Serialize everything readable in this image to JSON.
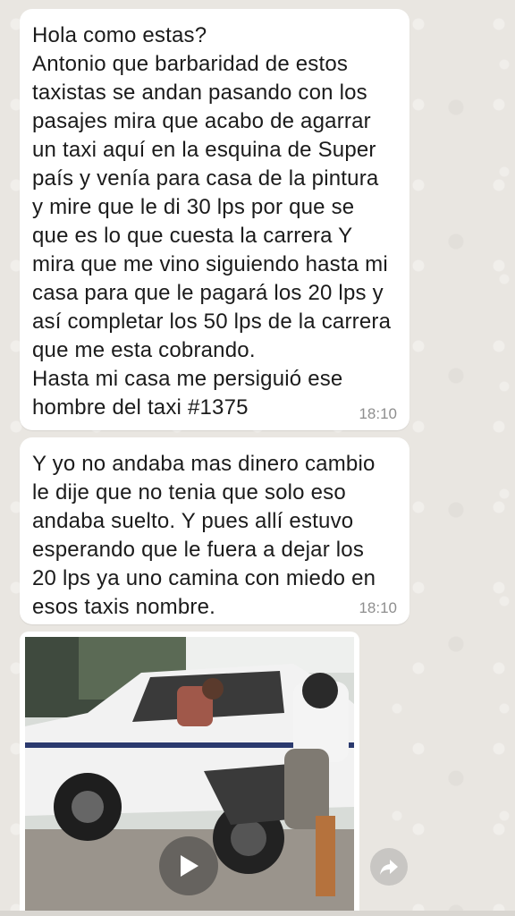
{
  "messages": [
    {
      "text": "Hola como estas?\nAntonio que barbaridad de estos taxistas se andan pasando con los pasajes mira que acabo de agarrar un taxi aquí en la esquina de Super país y venía para casa de la pintura y mire que le di 30  lps por que se que es lo que cuesta la carrera  Y mira que me vino siguiendo hasta mi casa para que le pagará los 20 lps y así completar los 50 lps de la carrera que me esta cobrando.\nHasta mi casa me persiguió ese hombre del taxi #1375",
      "time": "18:10"
    },
    {
      "text": "Y yo no andaba mas dinero cambio le dije que no tenia que solo eso andaba suelto. Y pues allí estuvo esperando que le fuera a dejar los 20 lps ya uno camina con miedo en esos taxis nombre.",
      "time": "18:10"
    }
  ],
  "media": {
    "type": "video",
    "play_icon": "play-icon",
    "forward_icon": "forward-icon"
  },
  "colors": {
    "bubble": "#ffffff",
    "background": "#e9e6e1",
    "timestamp": "#8e8e8e"
  }
}
